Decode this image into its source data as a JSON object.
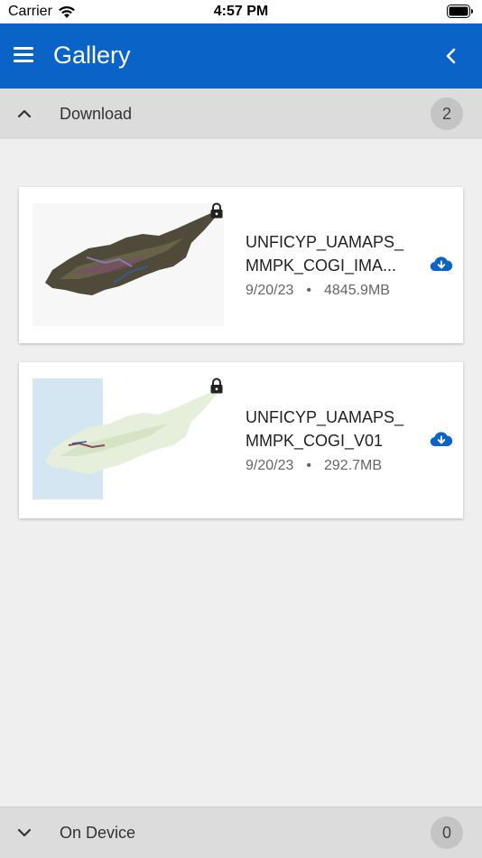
{
  "status_bar": {
    "carrier": "Carrier",
    "time": "4:57 PM"
  },
  "app_bar": {
    "title": "Gallery",
    "color": "#0a64c8"
  },
  "sections": {
    "download": {
      "label": "Download",
      "count": "2",
      "expanded": true
    },
    "on_device": {
      "label": "On Device",
      "count": "0",
      "expanded": false
    }
  },
  "items": [
    {
      "name_line1": "UNFICYP_UAMAPS_",
      "name_line2": "MMPK_COGI_IMA...",
      "date": "9/20/23",
      "dot": "•",
      "size": "4845.9MB",
      "locked": true,
      "thumbnail": "satellite-imagery-cyprus"
    },
    {
      "name_line1": "UNFICYP_UAMAPS_",
      "name_line2": "MMPK_COGI_V01",
      "date": "9/20/23",
      "dot": "•",
      "size": "292.7MB",
      "locked": true,
      "thumbnail": "vector-map-cyprus"
    }
  ],
  "icons": {
    "menu": "hamburger-icon",
    "back": "chevron-left-icon",
    "collapse": "chevron-up-icon",
    "expand": "chevron-down-icon",
    "lock": "lock-icon",
    "download": "cloud-download-icon"
  }
}
